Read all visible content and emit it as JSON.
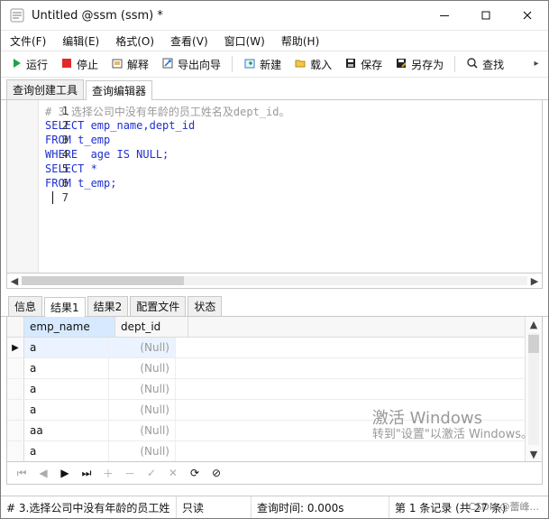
{
  "window": {
    "title": "Untitled @ssm (ssm) *"
  },
  "menu": {
    "items": [
      {
        "label": "文件(F)"
      },
      {
        "label": "编辑(E)"
      },
      {
        "label": "格式(O)"
      },
      {
        "label": "查看(V)"
      },
      {
        "label": "窗口(W)"
      },
      {
        "label": "帮助(H)"
      }
    ]
  },
  "toolbar": {
    "run": "运行",
    "stop": "停止",
    "explain": "解释",
    "export": "导出向导",
    "new": "新建",
    "load": "载入",
    "save": "保存",
    "save_as": "另存为",
    "find": "查找"
  },
  "tabs_top": [
    {
      "label": "查询创建工具"
    },
    {
      "label": "查询编辑器"
    }
  ],
  "editor": {
    "lines": [
      {
        "no": "1",
        "text": "# 3.选择公司中没有年龄的员工姓名及dept_id。"
      },
      {
        "no": "2",
        "text": "SELECT emp_name,dept_id"
      },
      {
        "no": "3",
        "text": "FROM t_emp"
      },
      {
        "no": "4",
        "text": "WHERE  age IS NULL;"
      },
      {
        "no": "5",
        "text": "SELECT *"
      },
      {
        "no": "6",
        "text": "FROM t_emp;"
      },
      {
        "no": "7",
        "text": ""
      }
    ]
  },
  "tabs_bottom": [
    {
      "label": "信息"
    },
    {
      "label": "结果1"
    },
    {
      "label": "结果2"
    },
    {
      "label": "配置文件"
    },
    {
      "label": "状态"
    }
  ],
  "grid": {
    "columns": [
      "emp_name",
      "dept_id"
    ],
    "rows": [
      {
        "emp_name": "a",
        "dept_id": "(Null)"
      },
      {
        "emp_name": "a",
        "dept_id": "(Null)"
      },
      {
        "emp_name": "a",
        "dept_id": "(Null)"
      },
      {
        "emp_name": "a",
        "dept_id": "(Null)"
      },
      {
        "emp_name": "aa",
        "dept_id": "(Null)"
      },
      {
        "emp_name": "a",
        "dept_id": "(Null)"
      }
    ]
  },
  "watermark": {
    "line1": "激活 Windows",
    "line2": "转到\"设置\"以激活 Windows。"
  },
  "statusbar": {
    "sql": "# 3.选择公司中没有年龄的员工姓",
    "readonly": "只读",
    "query_time": "查询时间: 0.000s",
    "records": "第 1 条记录 (共 27 条)",
    "extra": "CSDN @蕾峰..."
  },
  "colors": {
    "keyword": "#1f2fd0",
    "comment": "#9a9a9a",
    "selection": "#d7e9ff"
  },
  "icons": {
    "app": "navicat-icon",
    "run": "play-icon",
    "stop": "stop-icon",
    "explain": "explain-icon",
    "export": "export-wizard-icon",
    "new": "new-query-icon",
    "load": "folder-open-icon",
    "save": "save-icon",
    "save_as": "save-as-icon",
    "find": "search-icon"
  }
}
